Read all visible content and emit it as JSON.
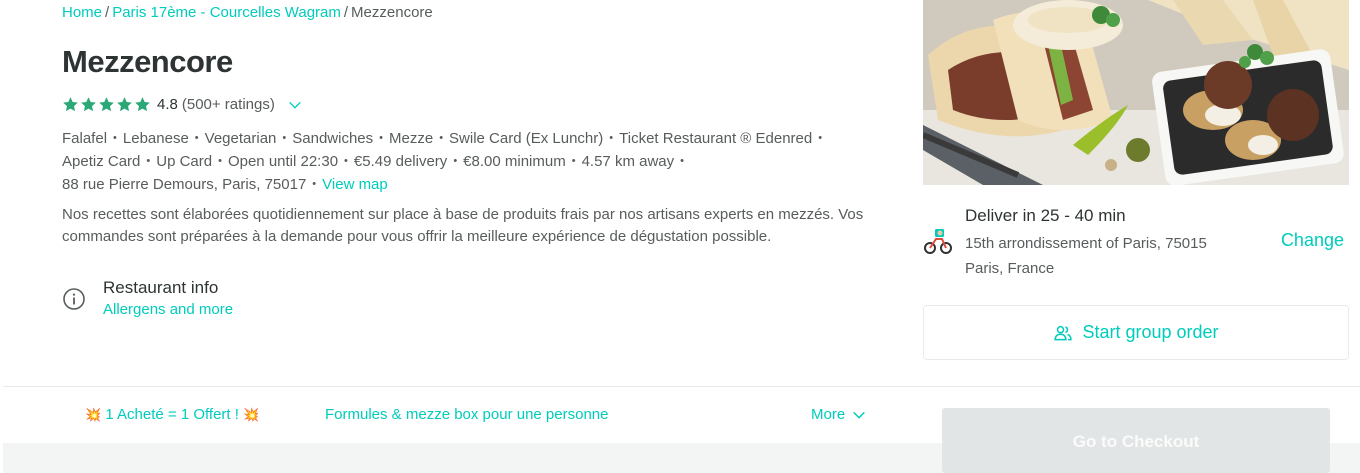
{
  "breadcrumb": {
    "home": "Home",
    "area": "Paris 17ème - Courcelles Wagram",
    "current": "Mezzencore",
    "separator": "/"
  },
  "restaurant": {
    "name": "Mezzencore",
    "rating_value": "4.8",
    "rating_count": "(500+ ratings)",
    "stars": 5,
    "star_color": "#2aa876",
    "tags": [
      "Falafel",
      "Lebanese",
      "Vegetarian",
      "Sandwiches",
      "Mezze",
      "Swile Card (Ex Lunchr)",
      "Ticket Restaurant ® Edenred",
      "Apetiz Card",
      "Up Card",
      "Open until 22:30",
      "€5.49 delivery",
      "€8.00 minimum",
      "4.57 km away",
      "88 rue Pierre Demours, Paris, 75017"
    ],
    "view_map": "View map",
    "description": "Nos recettes sont élaborées quotidiennement sur place à base de produits frais par nos artisans experts en mezzés. Vos commandes sont préparées à la demande pour vous offrir la meilleure expérience de dégustation possible."
  },
  "info": {
    "icon": "info-icon",
    "title": "Restaurant info",
    "link": "Allergens and more"
  },
  "delivery": {
    "icon": "bike-courier-icon",
    "title": "Deliver in 25 - 40 min",
    "address_line1": "15th arrondissement of Paris, 75015",
    "address_line2": "Paris, France",
    "change": "Change"
  },
  "group_order": {
    "icon": "users-icon",
    "label": "Start group order"
  },
  "menu_nav": {
    "items": [
      {
        "label": "1 Acheté = 1 Offert !",
        "prefix_icon": "💥",
        "suffix_icon": "💥"
      },
      {
        "label": "Formules & mezze box pour une personne"
      }
    ],
    "more": "More"
  },
  "checkout": {
    "label": "Go to Checkout"
  },
  "colors": {
    "accent": "#00ccbc",
    "text": "#2e3333",
    "muted": "#585c5c",
    "star": "#2aa876"
  }
}
